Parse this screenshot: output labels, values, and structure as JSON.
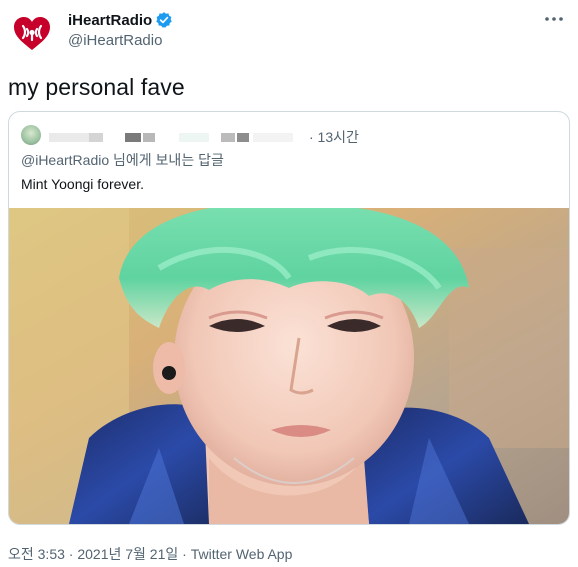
{
  "account": {
    "display_name": "iHeartRadio",
    "handle": "@iHeartRadio",
    "verified": true
  },
  "tweet": {
    "text": "my personal fave",
    "meta": "오전 3:53 · 2021년 7월 21일 · Twitter Web App"
  },
  "quoted_tweet": {
    "time": "· 13시간",
    "reply_to": "@iHeartRadio 님에게 보내는 답글",
    "text": "Mint Yoongi forever."
  },
  "icons": {
    "logo": "iheartradio-logo",
    "verified": "verified-badge-icon",
    "more": "more-options-icon"
  },
  "colors": {
    "brand_red": "#c6002b",
    "verified_blue": "#1d9bf0",
    "secondary_text": "#536471",
    "border": "#cfd9de"
  }
}
